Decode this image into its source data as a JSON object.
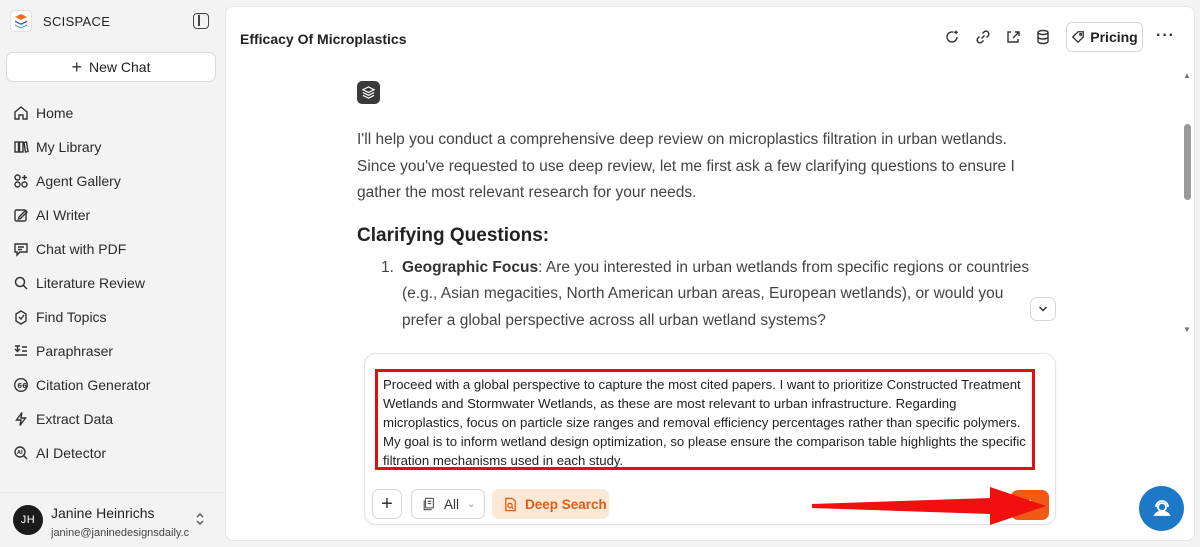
{
  "app": {
    "name": "SCISPACE"
  },
  "sidebar": {
    "new_chat_label": "New Chat",
    "items": [
      {
        "label": "Home",
        "icon": "home-icon"
      },
      {
        "label": "My Library",
        "icon": "library-icon"
      },
      {
        "label": "Agent Gallery",
        "icon": "agent-gallery-icon"
      },
      {
        "label": "AI Writer",
        "icon": "ai-writer-icon"
      },
      {
        "label": "Chat with PDF",
        "icon": "chat-pdf-icon"
      },
      {
        "label": "Literature Review",
        "icon": "search-icon"
      },
      {
        "label": "Find Topics",
        "icon": "find-topics-icon"
      },
      {
        "label": "Paraphraser",
        "icon": "paraphraser-icon"
      },
      {
        "label": "Citation Generator",
        "icon": "citation-icon"
      },
      {
        "label": "Extract Data",
        "icon": "extract-data-icon"
      },
      {
        "label": "AI Detector",
        "icon": "ai-detector-icon"
      }
    ]
  },
  "user": {
    "initials": "JH",
    "name": "Janine Heinrichs",
    "email": "janine@janinedesignsdaily.com"
  },
  "header": {
    "title": "Efficacy Of Microplastics",
    "pricing_label": "Pricing",
    "more_label": "···"
  },
  "conversation": {
    "intro": "I'll help you conduct a comprehensive deep review on microplastics filtration in urban wetlands. Since you've requested to use deep review, let me first ask a few clarifying questions to ensure I gather the most relevant research for your needs.",
    "heading": "Clarifying Questions:",
    "questions": [
      {
        "number": "1.",
        "term": "Geographic Focus",
        "text": ": Are you interested in urban wetlands from specific regions or countries (e.g., Asian megacities, North American urban areas, European wetlands), or would you prefer a global perspective across all urban wetland systems?"
      }
    ]
  },
  "composer": {
    "prompt": "Proceed with a global perspective to capture the most cited papers. I want to prioritize Constructed Treatment Wetlands and Stormwater Wetlands, as these are most relevant to urban infrastructure. Regarding microplastics, focus on particle size ranges and removal efficiency percentages rather than specific polymers. My goal is to inform wetland design optimization, so please ensure the comparison table highlights the specific filtration mechanisms used in each study.",
    "source_selected": "All",
    "deep_search_label": "Deep Search"
  },
  "colors": {
    "accent": "#f05a14",
    "annotation": "#e01010",
    "help_fab": "#1e78c8"
  }
}
